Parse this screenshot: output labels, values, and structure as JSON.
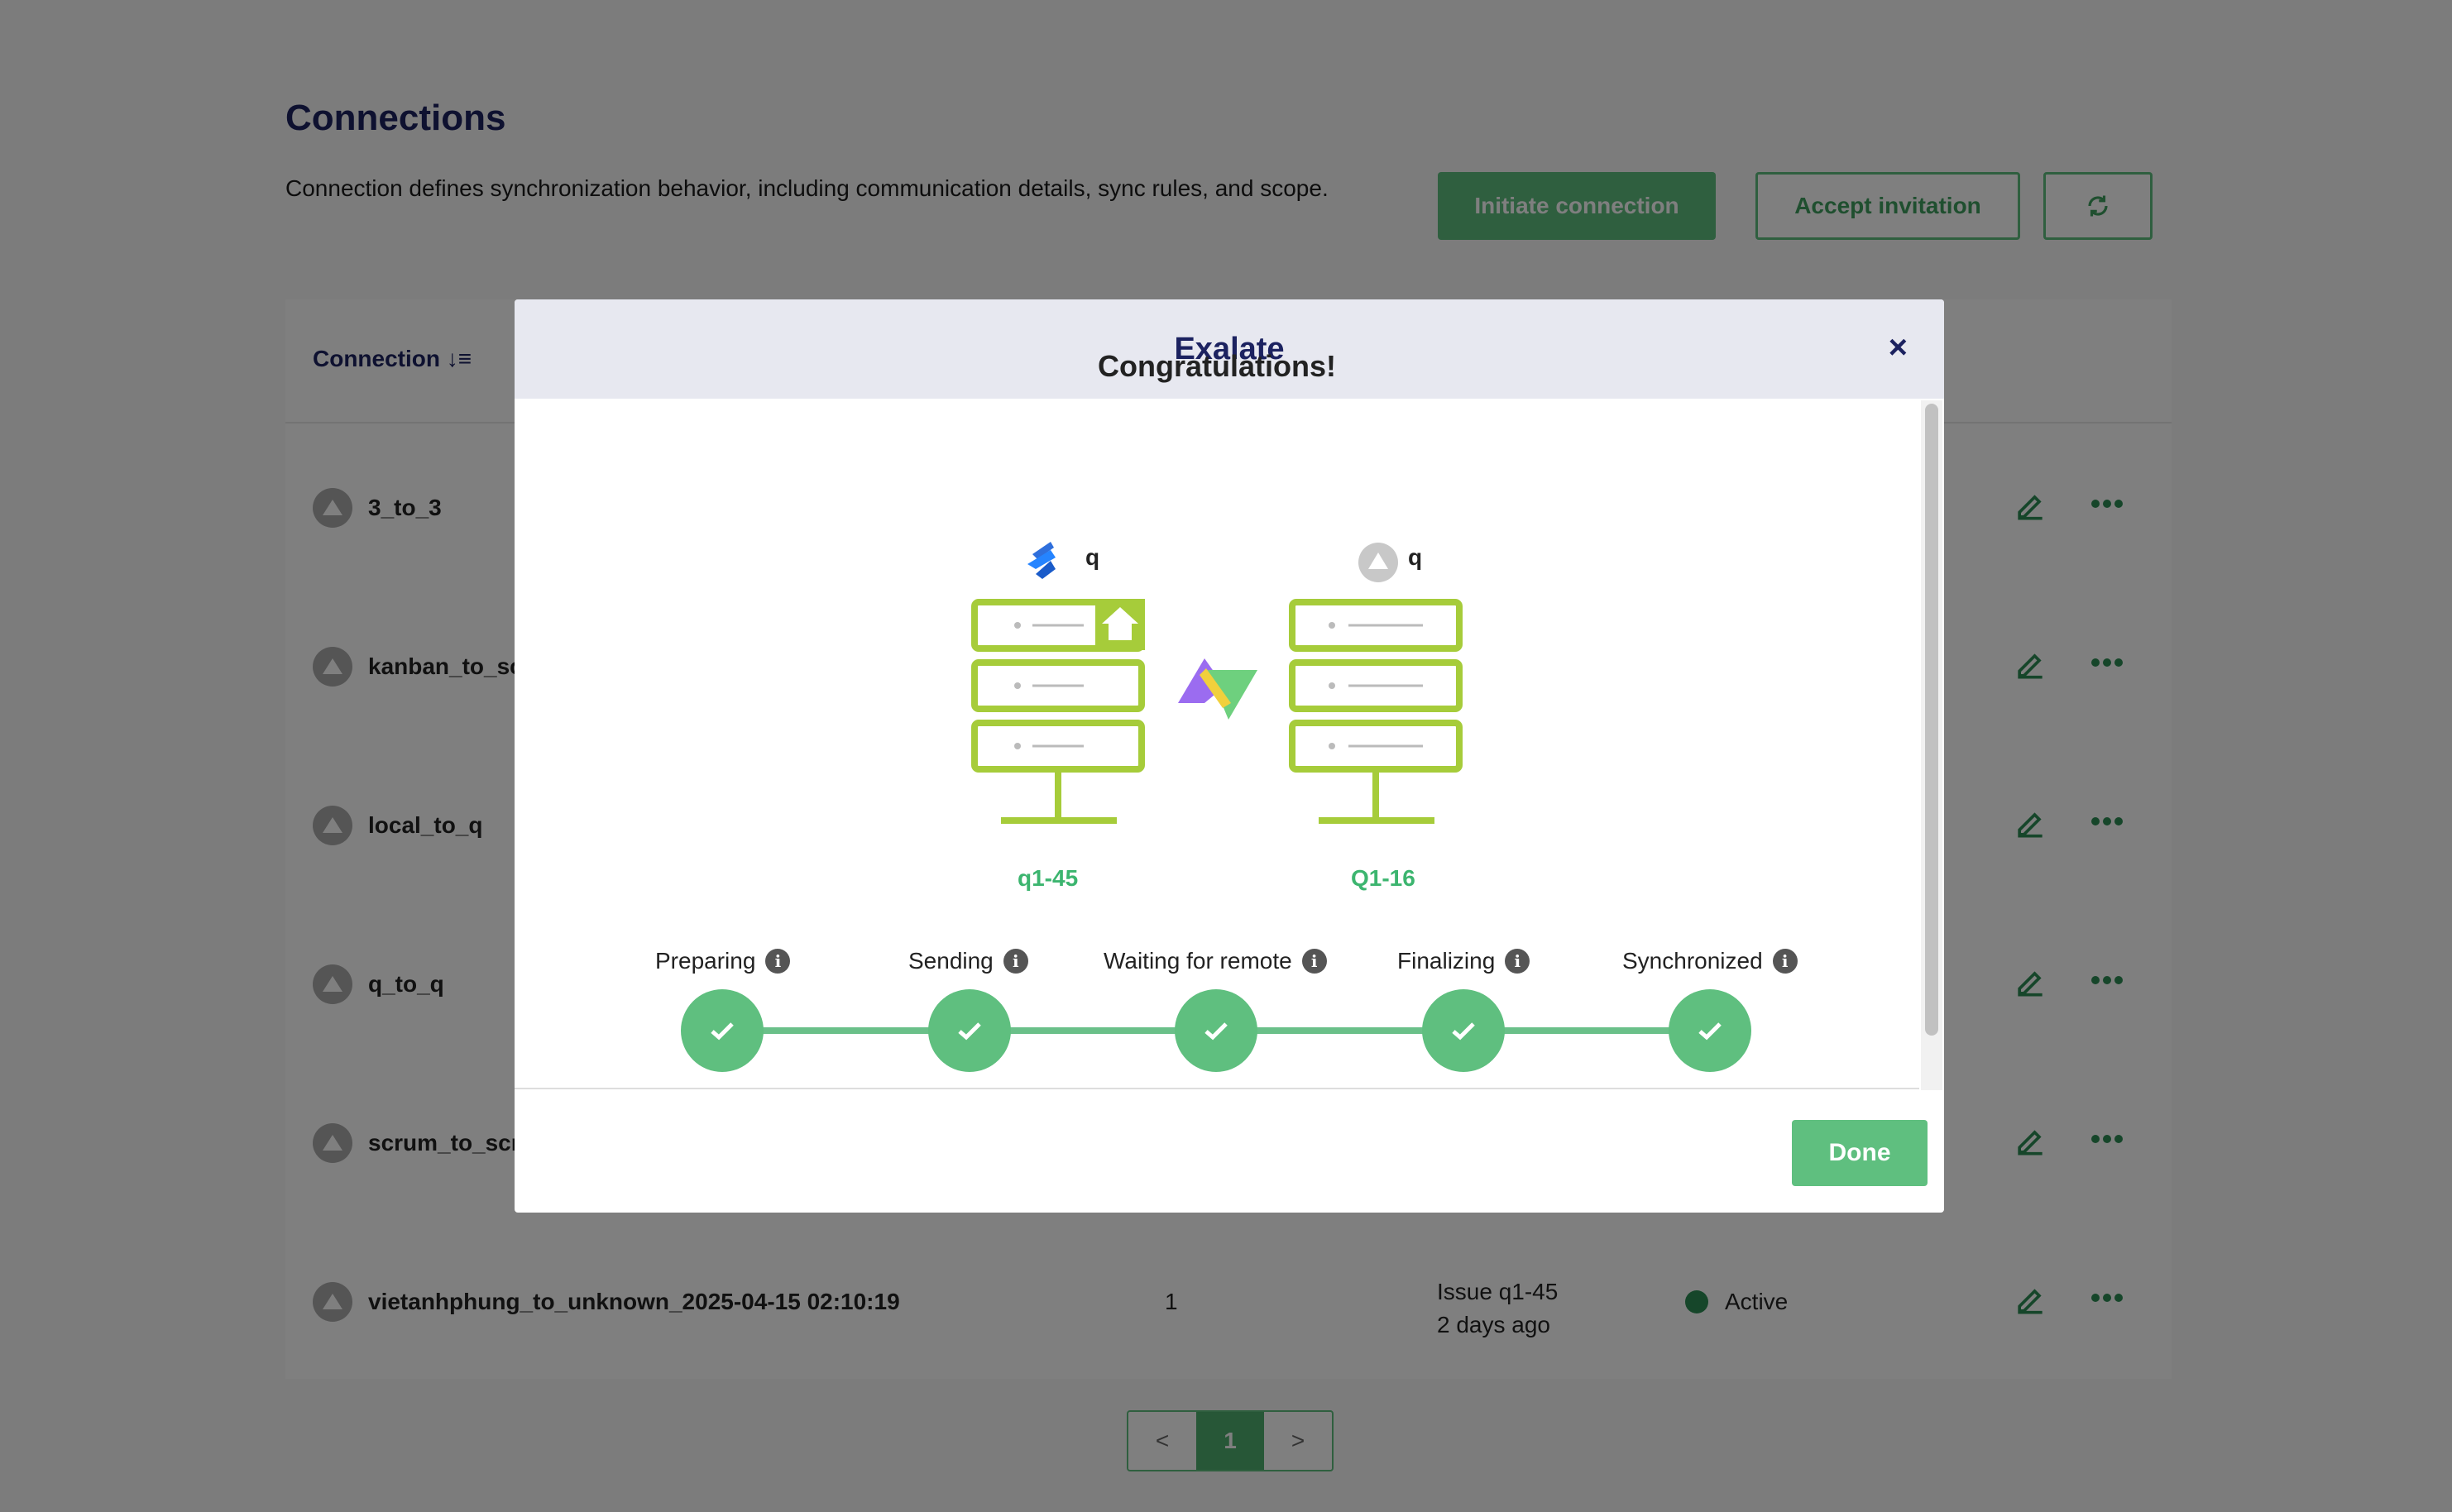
{
  "page": {
    "title": "Connections",
    "description": "Connection defines synchronization behavior, including communication details, sync rules, and scope.",
    "initiate_label": "Initiate connection",
    "accept_label": "Accept invitation"
  },
  "table": {
    "header_connection": "Connection",
    "rows": [
      {
        "name": "3_to_3"
      },
      {
        "name": "kanban_to_sc"
      },
      {
        "name": "local_to_q"
      },
      {
        "name": "q_to_q"
      },
      {
        "name": "scrum_to_scr"
      },
      {
        "name": "vietanhphung_to_unknown_2025-04-15 02:10:19",
        "count": "1",
        "issue": "Issue q1-45",
        "time": "2 days ago",
        "status": "Active"
      }
    ]
  },
  "pagination": {
    "prev": "<",
    "current": "1",
    "next": ">"
  },
  "modal": {
    "title": "Exalate",
    "close": "×",
    "congrats": "Congratulations!",
    "left_instance": "q",
    "right_instance": "q",
    "left_label": "q1-45",
    "right_label": "Q1-16",
    "steps": [
      "Preparing",
      "Sending",
      "Waiting for remote",
      "Finalizing",
      "Synchronized"
    ],
    "done_label": "Done"
  },
  "colors": {
    "accent": "#5fbf7f",
    "title": "#1c2260",
    "server": "#a6cc3a"
  }
}
